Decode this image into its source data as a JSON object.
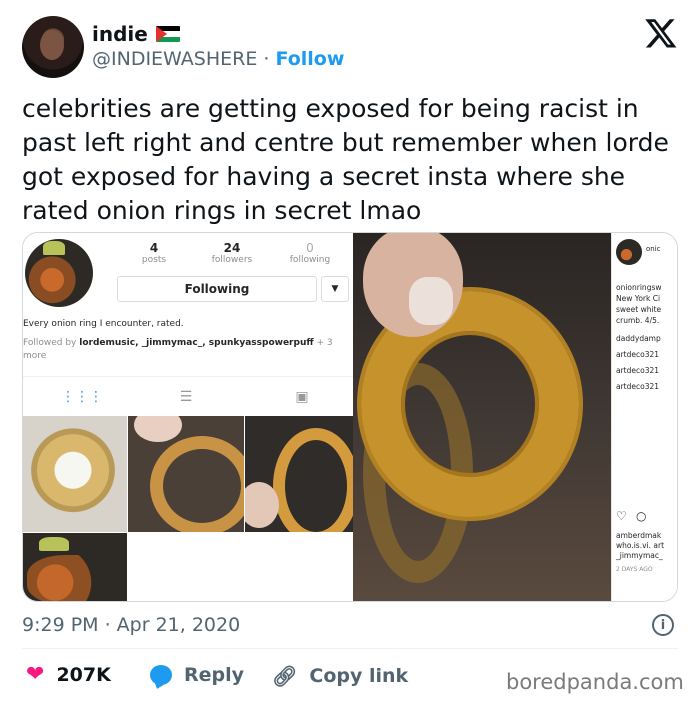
{
  "user": {
    "name": "indie",
    "handle": "@INDIEWASHERE",
    "separator": "·",
    "follow_label": "Follow"
  },
  "tweet": {
    "text": "celebrities are getting exposed for being racist in past left right and centre but remember when lorde got exposed for having a secret insta where she rated onion rings in secret lmao",
    "timestamp": "9:29 PM · Apr 21, 2020"
  },
  "instagram": {
    "stats": [
      {
        "value": "4",
        "label": "posts"
      },
      {
        "value": "24",
        "label": "followers"
      },
      {
        "value": "0",
        "label": "following"
      }
    ],
    "following_button": "Following",
    "bio": "Every onion ring I encounter, rated.",
    "followed_by_prefix": "Followed by",
    "followed_by_names": "lordemusic, _jimmymac_, spunkyasspowerpuff",
    "followed_by_more": "+ 3 more"
  },
  "post_side": {
    "username": "onic",
    "lines": [
      "onionringsw",
      "New York Ci",
      "sweet white",
      "crumb. 4/5.",
      "daddydamp",
      "artdeco321",
      "artdeco321",
      "artdeco321"
    ],
    "comment_lines": [
      "amberdmak",
      "who.is.vi. art",
      "_jimmymac_"
    ],
    "time_ago": "2 DAYS AGO"
  },
  "actions": {
    "likes": "207K",
    "reply": "Reply",
    "copy_link": "Copy link"
  },
  "watermark": "boredpanda.com",
  "colors": {
    "accent": "#1d9bf0",
    "heart": "#f91880",
    "secondary_text": "#536471"
  },
  "icons": [
    "flag-icon",
    "x-logo-icon",
    "caret-down-icon",
    "grid-icon",
    "list-icon",
    "tagged-icon",
    "heart-outline-icon",
    "comment-icon",
    "info-icon",
    "heart-icon",
    "reply-icon",
    "link-icon"
  ]
}
